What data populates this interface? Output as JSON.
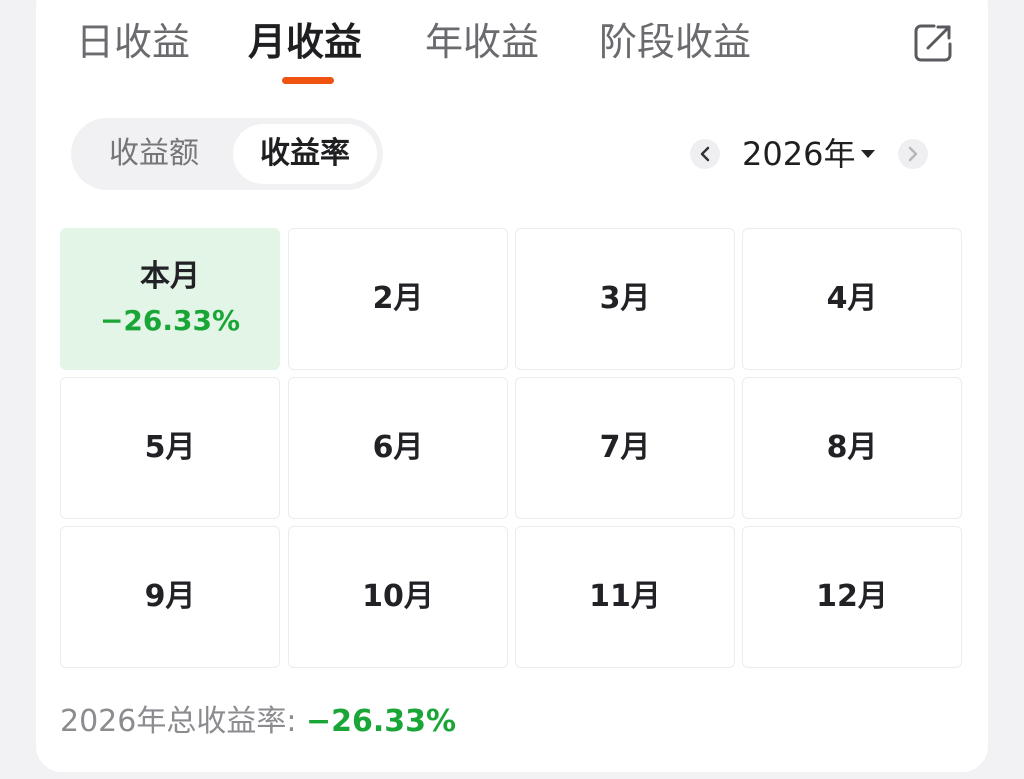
{
  "tabs": [
    {
      "label": "日收益"
    },
    {
      "label": "月收益"
    },
    {
      "label": "年收益"
    },
    {
      "label": "阶段收益"
    }
  ],
  "active_tab_index": 1,
  "toggle": {
    "amount_label": "收益额",
    "rate_label": "收益率",
    "selected": "收益率"
  },
  "year_picker": {
    "year": "2026年"
  },
  "months": [
    {
      "label": "本月",
      "value": "−26.33%",
      "current": true
    },
    {
      "label": "2月"
    },
    {
      "label": "3月"
    },
    {
      "label": "4月"
    },
    {
      "label": "5月"
    },
    {
      "label": "6月"
    },
    {
      "label": "7月"
    },
    {
      "label": "8月"
    },
    {
      "label": "9月"
    },
    {
      "label": "10月"
    },
    {
      "label": "11月"
    },
    {
      "label": "12月"
    }
  ],
  "total": {
    "label": "2026年总收益率: ",
    "value": "−26.33%"
  },
  "colors": {
    "accent": "#f0520f",
    "loss": "#1aa537",
    "current_cell_bg": "#e3f5e6"
  },
  "icons": {
    "share": "share-icon",
    "prev": "chevron-left-icon",
    "next": "chevron-right-icon",
    "dropdown": "caret-down-icon"
  }
}
